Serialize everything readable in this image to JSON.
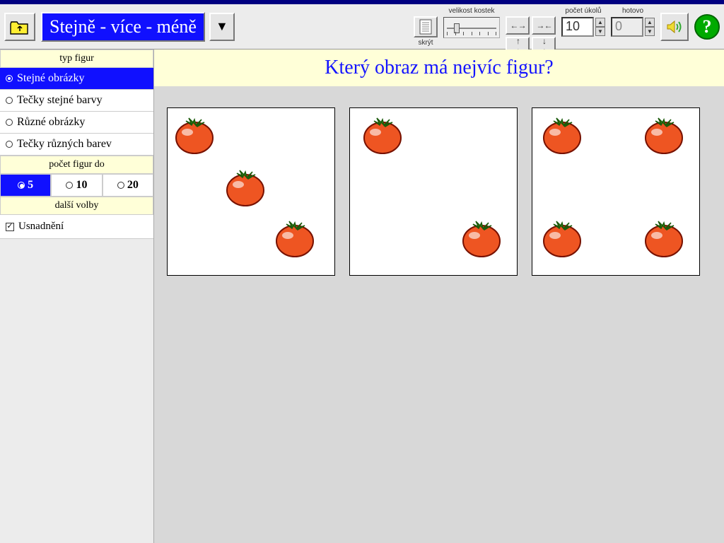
{
  "toolbar": {
    "heading": "Stejně - více - méně",
    "hide_label": "skrýt",
    "size_label": "velikost kostek",
    "tasks_label": "počet úkolů",
    "tasks_value": "10",
    "done_label": "hotovo",
    "done_value": "0"
  },
  "sidebar": {
    "type_label": "typ figur",
    "type_options": [
      "Stejné obrázky",
      "Tečky stejné barvy",
      "Různé obrázky",
      "Tečky různých barev"
    ],
    "type_selected": 0,
    "count_label": "počet figur do",
    "count_options": [
      "5",
      "10",
      "20"
    ],
    "count_selected": 0,
    "other_label": "další volby",
    "simplify_label": "Usnadnění",
    "simplify_checked": true
  },
  "question": "Který obraz má nejvíc figur?",
  "panels": [
    {
      "positions": [
        [
          8,
          6
        ],
        [
          80,
          80
        ],
        [
          150,
          152
        ]
      ]
    },
    {
      "positions": [
        [
          16,
          6
        ],
        [
          156,
          152
        ]
      ]
    },
    {
      "positions": [
        [
          12,
          6
        ],
        [
          156,
          6
        ],
        [
          12,
          152
        ],
        [
          156,
          152
        ]
      ]
    }
  ]
}
